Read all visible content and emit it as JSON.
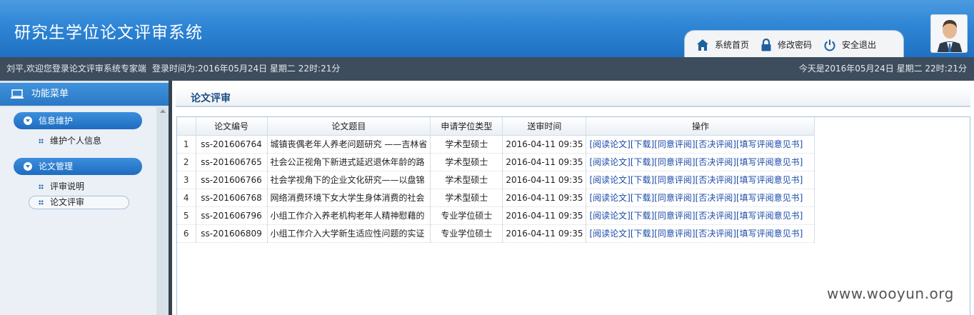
{
  "header": {
    "title": "研究生学位论文评审系统",
    "nav": [
      {
        "label": "系统首页",
        "icon": "home-icon"
      },
      {
        "label": "修改密码",
        "icon": "lock-icon"
      },
      {
        "label": "安全退出",
        "icon": "power-icon"
      }
    ]
  },
  "infobar": {
    "welcome": "刘平,欢迎您登录论文评审系统专家端",
    "login_time": "登录时间为:2016年05月24日 星期二 22时:21分",
    "today": "今天是2016年05月24日 星期二 22时:21分"
  },
  "sidebar": {
    "title": "功能菜单",
    "groups": [
      {
        "label": "信息维护",
        "items": [
          {
            "label": "维护个人信息"
          }
        ]
      },
      {
        "label": "论文管理",
        "items": [
          {
            "label": "评审说明"
          },
          {
            "label": "论文评审"
          }
        ]
      }
    ]
  },
  "main": {
    "section_title": "论文评审",
    "table": {
      "headers": [
        "",
        "论文编号",
        "论文题目",
        "申请学位类型",
        "送审时间",
        "操作"
      ],
      "actions": [
        "[阅读论文]",
        "[下载]",
        "[同意评阅]",
        "[否决评阅]",
        "[填写评阅意见书]"
      ],
      "rows": [
        {
          "num": "1",
          "code": "ss-201606764",
          "title": "城镇丧偶老年人养老问题研究 ——吉林省",
          "type": "学术型硕士",
          "time": "2016-04-11 09:35"
        },
        {
          "num": "2",
          "code": "ss-201606765",
          "title": "社会公正视角下新进式延迟退休年龄的路",
          "type": "学术型硕士",
          "time": "2016-04-11 09:35"
        },
        {
          "num": "3",
          "code": "ss-201606766",
          "title": "社会学视角下的企业文化研究——以盘锦",
          "type": "学术型硕士",
          "time": "2016-04-11 09:35"
        },
        {
          "num": "4",
          "code": "ss-201606768",
          "title": "网络消费环境下女大学生身体消费的社会",
          "type": "学术型硕士",
          "time": "2016-04-11 09:35"
        },
        {
          "num": "5",
          "code": "ss-201606796",
          "title": "小组工作介入养老机构老年人精神慰藉的",
          "type": "专业学位硕士",
          "time": "2016-04-11 09:35"
        },
        {
          "num": "6",
          "code": "ss-201606809",
          "title": "小组工作介入大学新生适应性问题的实证",
          "type": "专业学位硕士",
          "time": "2016-04-11 09:35"
        }
      ]
    }
  },
  "watermark": "www.wooyun.org"
}
